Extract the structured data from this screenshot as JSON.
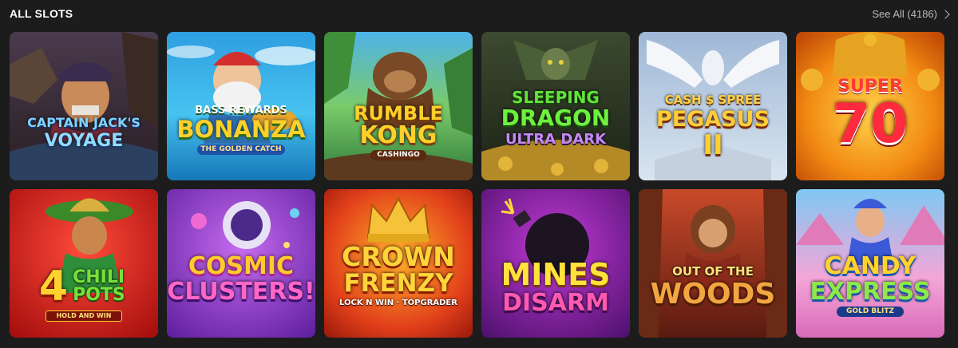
{
  "section": {
    "title": "ALL SLOTS",
    "see_all_label": "See All (4186)"
  },
  "games": [
    {
      "id": "captain-jacks-voyage",
      "line1": "CAPTAIN JACK'S",
      "line2": "VOYAGE",
      "line3": ""
    },
    {
      "id": "bass-rewards-bonanza",
      "line1": "BASS REWARDS",
      "line2": "BONANZA",
      "line3": "THE GOLDEN CATCH"
    },
    {
      "id": "rumble-kong",
      "line1": "RUMBLE",
      "line2": "KONG",
      "line3": "CASHINGO"
    },
    {
      "id": "sleeping-dragon",
      "line1": "SLEEPING",
      "line2": "DRAGON",
      "line3": "ULTRA DARK"
    },
    {
      "id": "cash-spree-pegasus",
      "line1": "CASH $ SPREE",
      "line2": "PEGASUS",
      "line3": "II"
    },
    {
      "id": "super-70",
      "line1": "SUPER",
      "line2": "70",
      "line3": ""
    },
    {
      "id": "4-chili-pots",
      "line1": "4",
      "line2": "CHILI POTS",
      "line3": "HOLD AND WIN"
    },
    {
      "id": "cosmic-clusters",
      "line1": "COSMIC",
      "line2": "CLUSTERS!",
      "line3": ""
    },
    {
      "id": "crown-frenzy",
      "line1": "CROWN",
      "line2": "FRENZY",
      "line3": "LOCK N WIN · TOPGRADER"
    },
    {
      "id": "mines-disarm",
      "line1": "MINES",
      "line2": "DISARM",
      "line3": ""
    },
    {
      "id": "out-of-the-woods",
      "line1": "OUT OF THE",
      "line2": "WOODS",
      "line3": ""
    },
    {
      "id": "candy-express",
      "line1": "CANDY",
      "line2": "EXPRESS",
      "line3": "GOLD BLITZ"
    }
  ]
}
